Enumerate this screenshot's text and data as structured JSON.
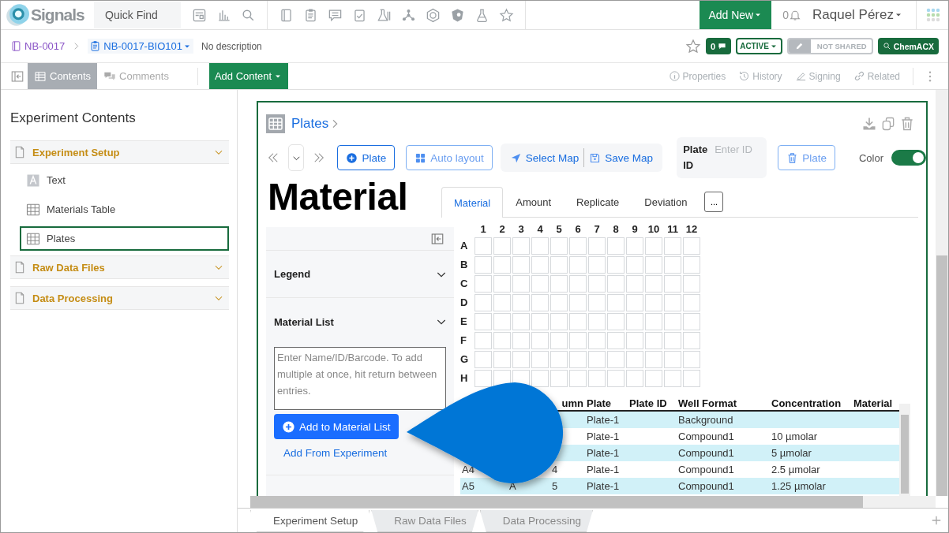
{
  "app": {
    "logo": "Signals",
    "quick_find": "Quick Find",
    "add_new": "Add New",
    "notifications": "0",
    "user": "Raquel Pérez"
  },
  "breadcrumb": {
    "notebook": "NB-0017",
    "experiment": "NB-0017-BIO101",
    "description": "No description"
  },
  "status": {
    "comments": "0",
    "state": "ACTIVE",
    "sharing": "NOT SHARED",
    "search": "ChemACX"
  },
  "view_tabs": [
    {
      "label": "Contents",
      "selected": true
    },
    {
      "label": "Comments",
      "selected": false
    }
  ],
  "add_content": "Add Content",
  "side_actions": [
    {
      "label": "Properties",
      "kind": "info"
    },
    {
      "label": "History",
      "kind": "history"
    },
    {
      "label": "Signing",
      "kind": "sign"
    },
    {
      "label": "Related",
      "kind": "link"
    }
  ],
  "sidebar": {
    "title": "Experiment Contents",
    "sections": [
      {
        "label": "Experiment Setup",
        "children": [
          {
            "label": "Text",
            "kind": "text",
            "selected": false
          },
          {
            "label": "Materials Table",
            "kind": "table",
            "selected": false
          },
          {
            "label": "Plates",
            "kind": "plate",
            "selected": true
          }
        ]
      },
      {
        "label": "Raw Data Files"
      },
      {
        "label": "Data Processing"
      }
    ]
  },
  "panel": {
    "title": "Plates",
    "toolbar": {
      "add_plate": "Plate",
      "auto_layout": "Auto layout",
      "select_map": "Select Map",
      "save_map": "Save Map",
      "plate_id_label": "Plate ID",
      "plate_id_placeholder": "Enter ID",
      "delete_plate": "Plate",
      "color_toggle": {
        "label": "Color",
        "on": true
      }
    },
    "heading": "Material",
    "tabs": [
      {
        "label": "Material",
        "selected": true
      },
      {
        "label": "Amount",
        "selected": false
      },
      {
        "label": "Replicate",
        "selected": false
      },
      {
        "label": "Deviation",
        "selected": false
      }
    ],
    "more": "...",
    "legend": "Legend",
    "material_list": {
      "label": "Material List",
      "placeholder": "Enter Name/ID/Barcode. To add multiple at once, hit return between entries.",
      "add_button": "Add to Material List",
      "add_from": "Add From Experiment"
    },
    "plate": {
      "columns": [
        "1",
        "2",
        "3",
        "4",
        "5",
        "6",
        "7",
        "8",
        "9",
        "10",
        "11",
        "12"
      ],
      "rows": [
        "A",
        "B",
        "C",
        "D",
        "E",
        "F",
        "G",
        "H"
      ]
    },
    "table": {
      "columns": [
        "umn",
        "Plate",
        "Plate ID",
        "Well Format",
        "Concentration",
        "Material"
      ],
      "rows": [
        {
          "plate": "Plate-1",
          "well_format": "Background"
        },
        {
          "plate": "Plate-1",
          "well_format": "Compound1",
          "concentration": "10 µmolar"
        },
        {
          "plate": "Plate-1",
          "well_format": "Compound1",
          "concentration": "5 µmolar"
        },
        {
          "well": "A4",
          "column": "4",
          "plate": "Plate-1",
          "well_format": "Compound1",
          "concentration": "2.5 µmolar"
        },
        {
          "well": "A5",
          "row": "A",
          "column": "5",
          "plate": "Plate-1",
          "well_format": "Compound1",
          "concentration": "1.25 µmolar"
        }
      ]
    }
  },
  "sheet_tabs": [
    {
      "label": "Experiment Setup",
      "selected": true
    },
    {
      "label": "Raw Data Files",
      "selected": false
    },
    {
      "label": "Data Processing",
      "selected": false
    }
  ]
}
